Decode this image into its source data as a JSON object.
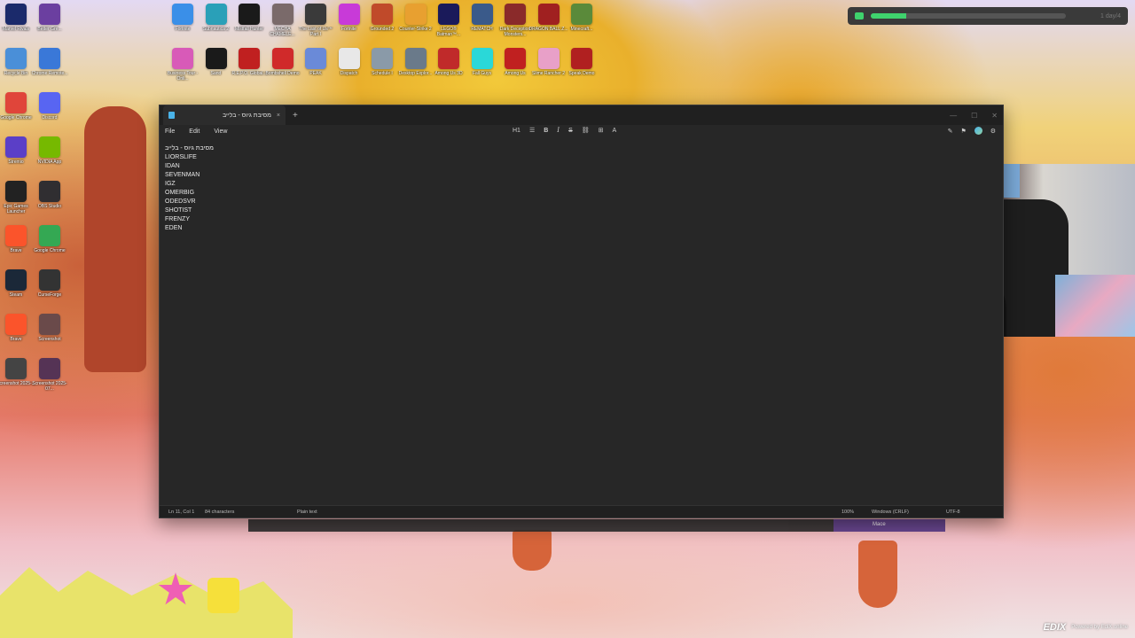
{
  "desktop": {
    "icons_left": [
      {
        "label": "Marvel Rivals",
        "color": "#1b2a6b"
      },
      {
        "label": "Better Gre...",
        "color": "#6b3fa0"
      },
      {
        "label": "Recycle Bin",
        "color": "#4a8fd8"
      },
      {
        "label": "Chrome Remote...",
        "color": "#3a78d8"
      },
      {
        "label": "Google Chrome",
        "color": "#e0453a"
      },
      {
        "label": "Discord",
        "color": "#5865f2"
      },
      {
        "label": "Stremio",
        "color": "#5b3fc7"
      },
      {
        "label": "NVIDIA App",
        "color": "#76b900"
      },
      {
        "label": "Epic Games Launcher",
        "color": "#222222"
      },
      {
        "label": "OBS Studio",
        "color": "#302e31"
      },
      {
        "label": "Brave",
        "color": "#fb542b"
      },
      {
        "label": "Google Chrome",
        "color": "#34a853"
      },
      {
        "label": "Steam",
        "color": "#1b2838"
      },
      {
        "label": "CurseForge",
        "color": "#333333"
      },
      {
        "label": "Brave",
        "color": "#fb542b"
      },
      {
        "label": "Screenshot",
        "color": "#6a4a4a"
      },
      {
        "label": "Screenshot 2025-...",
        "color": "#444444"
      },
      {
        "label": "Screenshot 2025-07...",
        "color": "#553355"
      }
    ],
    "icons_top": [
      {
        "label": "Fortnite",
        "color": "#3a8fe8"
      },
      {
        "label": "Subnautica 2",
        "color": "#2aa0b8"
      },
      {
        "label": "Mistfall Hunter",
        "color": "#1a1a1a"
      },
      {
        "label": "MECHA CHAMELE...",
        "color": "#7a6a6a"
      },
      {
        "label": "The Last of Us™ Part I",
        "color": "#3a3a3a"
      },
      {
        "label": "Fortnite",
        "color": "#c83ad8"
      },
      {
        "label": "Grounded 2",
        "color": "#c04a2a"
      },
      {
        "label": "Counter-Strike 2",
        "color": "#e8a030"
      },
      {
        "label": "LEGO® Batman™...",
        "color": "#1a1a5a"
      },
      {
        "label": "REMATCH",
        "color": "#3a5a8a"
      },
      {
        "label": "Dark Deception Monsters...",
        "color": "#8a2a2a"
      },
      {
        "label": "DRAGON BALL Z...",
        "color": "#a02020"
      },
      {
        "label": "Minecraft...",
        "color": "#5a8a3a"
      },
      {
        "label": "Business Tour - Onli...",
        "color": "#d85ab8"
      },
      {
        "label": "Sand",
        "color": "#1a1a1a"
      },
      {
        "label": "R.E.P.O. Global...",
        "color": "#c02020"
      },
      {
        "label": "Bombshell Demo",
        "color": "#d02a2a"
      },
      {
        "label": "PEAK",
        "color": "#6a8ad8"
      },
      {
        "label": "Dispatch",
        "color": "#e8e8e8"
      },
      {
        "label": "Schedule I",
        "color": "#8a9aa8"
      },
      {
        "label": "Desktop Explor...",
        "color": "#6a7a8a"
      },
      {
        "label": "Among Us 3D",
        "color": "#c02a2a"
      },
      {
        "label": "Fall Guys",
        "color": "#2ad8d8"
      },
      {
        "label": "Among Us",
        "color": "#c02020"
      },
      {
        "label": "Slime Rancher 2",
        "color": "#e8a0c8"
      },
      {
        "label": "Speak Demo",
        "color": "#b02020"
      }
    ]
  },
  "topbar": {
    "progress": 0.18,
    "count": "1 day/4"
  },
  "notepad": {
    "tab_title": "מסיבת גיוס - בלייב",
    "new_tab": "+",
    "close_tab": "×",
    "menus": [
      "File",
      "Edit",
      "View"
    ],
    "format": {
      "heading": "H1",
      "list": "☰",
      "bold": "B",
      "italic": "I",
      "strike": "S",
      "link": "⛓",
      "table": "⊞",
      "clear": "A"
    },
    "lines": [
      "מסיבת גיוס - בלייב",
      "LIORSLIFE",
      "IDAN",
      "SEVENMAN",
      "IGZ",
      "OMERBIG",
      "ODEDSVR",
      "SHOTIST",
      "FRENZY",
      "EDEN"
    ],
    "status": {
      "position": "Ln 11, Col 1",
      "chars": "84 characters",
      "format": "Plain text",
      "zoom": "100%",
      "eol": "Windows (CRLF)",
      "encoding": "UTF-8"
    }
  },
  "taskbar_preview": {
    "mace": "Mace"
  },
  "watermark": {
    "logo": "EDIX",
    "powered": "Powered by EdiX.online"
  }
}
